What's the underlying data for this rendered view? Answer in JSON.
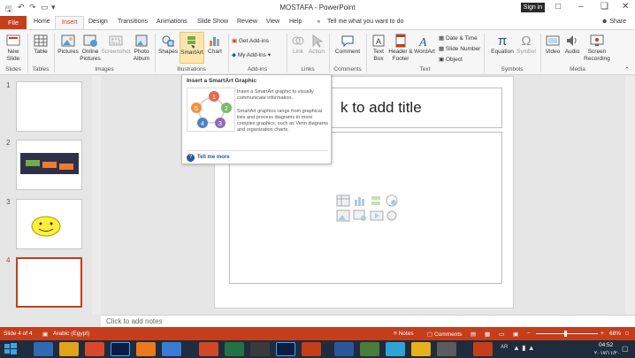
{
  "app": {
    "title": "MOSTAFA  -  PowerPoint",
    "signin": "Sign in",
    "share": "Share",
    "tell_me": "Tell me what you want to do"
  },
  "tabs": [
    "File",
    "Home",
    "Insert",
    "Design",
    "Transitions",
    "Animations",
    "Slide Show",
    "Review",
    "View",
    "Help"
  ],
  "ribbon": {
    "slides": {
      "new_slide": "New Slide",
      "group": "Slides"
    },
    "tables": {
      "table": "Table",
      "group": "Tables"
    },
    "images": {
      "pictures": "Pictures",
      "online_pictures": "Online Pictures",
      "screenshot": "Screenshot",
      "photo_album": "Photo Album",
      "group": "Images"
    },
    "illustrations": {
      "shapes": "Shapes",
      "smartart": "SmartArt",
      "chart": "Chart",
      "group": "Illustrations"
    },
    "addins": {
      "get_addins": "Get Add-ins",
      "my_addins": "My Add-ins",
      "group": "Add-ins"
    },
    "links": {
      "link": "Link",
      "action": "Action",
      "group": "Links"
    },
    "comments": {
      "comment": "Comment",
      "group": "Comments"
    },
    "text": {
      "text_box": "Text Box",
      "header_footer": "Header & Footer",
      "wordart": "WordArt",
      "date_time": "Date & Time",
      "slide_number": "Slide Number",
      "object": "Object",
      "group": "Text"
    },
    "symbols": {
      "equation": "Equation",
      "symbol": "Symbol",
      "group": "Symbols"
    },
    "media": {
      "video": "Video",
      "audio": "Audio",
      "screen_recording": "Screen Recording",
      "group": "Media"
    }
  },
  "tooltip": {
    "title": "Insert a SmartArt Graphic",
    "desc1": "Insert a SmartArt graphic to visually communicate information.",
    "desc2": "SmartArt graphics range from graphical lists and process diagrams to more complex graphics, such as Venn diagrams and organization charts.",
    "help": "Tell me more",
    "cycle_numbers": [
      "1",
      "2",
      "3",
      "4",
      "5"
    ]
  },
  "slides_panel": {
    "numbers": [
      "1",
      "2",
      "3",
      "4"
    ],
    "selected": "4"
  },
  "slide": {
    "title_placeholder": "k to add title",
    "notes_placeholder": "Click to add notes"
  },
  "status": {
    "slide_info": "Slide 4 of 4",
    "language": "Arabic (Egypt)",
    "notes": "Notes",
    "comments": "Comments",
    "zoom": "68%"
  },
  "taskbar": {
    "time": "04:52",
    "date": "٢٠١٧/١١/٢٠",
    "lang": "AR"
  },
  "colors": {
    "accent": "#c43e1c",
    "taskbar": "#1f2c3d"
  }
}
